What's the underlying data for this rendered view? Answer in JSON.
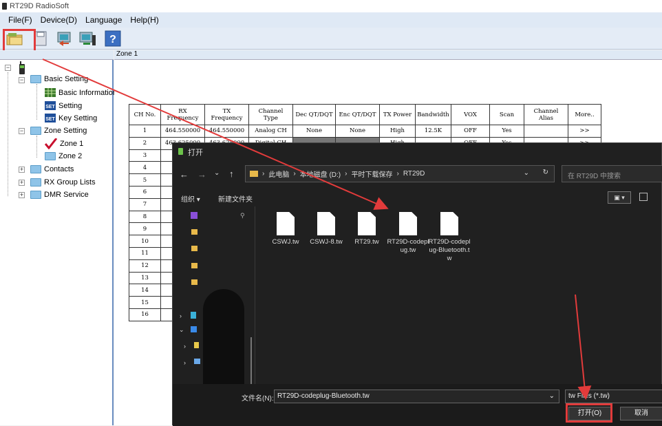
{
  "app": {
    "title": "RT29D RadioSoft"
  },
  "menu": {
    "file": "File(F)",
    "device": "Device(D)",
    "language": "Language",
    "help": "Help(H)"
  },
  "tree": {
    "basic_setting": "Basic Setting",
    "basic_information": "Basic Information",
    "setting": "Setting",
    "key_setting": "Key Setting",
    "zone_setting": "Zone Setting",
    "zone1": "Zone 1",
    "zone2": "Zone 2",
    "contacts": "Contacts",
    "rx_group_lists": "RX Group Lists",
    "dmr_service": "DMR Service"
  },
  "zone_header": "Zone 1",
  "table": {
    "headers": [
      "CH No.",
      "RX Frequency",
      "TX Frequency",
      "Channel Type",
      "Dec QT/DQT",
      "Enc QT/DQT",
      "TX Power",
      "Bandwidth",
      "VOX",
      "Scan",
      "Channel Alias",
      "More.."
    ],
    "rows": [
      [
        "1",
        "464.550000",
        "464.550000",
        "Analog CH",
        "None",
        "None",
        "High",
        "12.5K",
        "OFF",
        "Yes",
        "",
        ">>"
      ],
      [
        "2",
        "463.625000",
        "463.625000",
        "Digital CH",
        "",
        "",
        "High",
        "",
        "OFF",
        "Yes",
        "",
        ">>"
      ],
      [
        "3",
        "46",
        "",
        "",
        "",
        "",
        "",
        "",
        "",
        "",
        "",
        ""
      ],
      [
        "4",
        "46",
        "",
        "",
        "",
        "",
        "",
        "",
        "",
        "",
        "",
        ""
      ],
      [
        "5",
        "46",
        "",
        "",
        "",
        "",
        "",
        "",
        "",
        "",
        "",
        ""
      ],
      [
        "6",
        "46",
        "",
        "",
        "",
        "",
        "",
        "",
        "",
        "",
        "",
        ""
      ],
      [
        "7",
        "46",
        "",
        "",
        "",
        "",
        "",
        "",
        "",
        "",
        "",
        ""
      ],
      [
        "8",
        "46",
        "",
        "",
        "",
        "",
        "",
        "",
        "",
        "",
        "",
        ""
      ],
      [
        "9",
        "46",
        "",
        "",
        "",
        "",
        "",
        "",
        "",
        "",
        "",
        ""
      ],
      [
        "10",
        "46",
        "",
        "",
        "",
        "",
        "",
        "",
        "",
        "",
        "",
        ""
      ],
      [
        "11",
        "46",
        "",
        "",
        "",
        "",
        "",
        "",
        "",
        "",
        "",
        ""
      ],
      [
        "12",
        "46",
        "",
        "",
        "",
        "",
        "",
        "",
        "",
        "",
        "",
        ""
      ],
      [
        "13",
        "46",
        "",
        "",
        "",
        "",
        "",
        "",
        "",
        "",
        "",
        ""
      ],
      [
        "14",
        "46",
        "",
        "",
        "",
        "",
        "",
        "",
        "",
        "",
        "",
        ""
      ],
      [
        "15",
        "46",
        "",
        "",
        "",
        "",
        "",
        "",
        "",
        "",
        "",
        ""
      ],
      [
        "16",
        "46",
        "",
        "",
        "",
        "",
        "",
        "",
        "",
        "",
        "",
        ""
      ]
    ]
  },
  "dialog": {
    "title": "打开",
    "breadcrumb": [
      "此电脑",
      "本地磁盘 (D:)",
      "平时下载保存",
      "RT29D"
    ],
    "search_placeholder": "在 RT29D 中搜索",
    "organize": "组织",
    "new_folder": "新建文件夹",
    "files": [
      "CSWJ.tw",
      "CSWJ-8.tw",
      "RT29.tw",
      "RT29D-codeplug.tw",
      "RT29D-codeplug-Bluetooth.tw"
    ],
    "filename_label": "文件名(N):",
    "filename_value": "RT29D-codeplug-Bluetooth.tw",
    "filetype": "tw Files (*.tw)",
    "open_button": "打开(O)",
    "cancel_button": "取消"
  },
  "colors": {
    "annotation": "#e23b3b",
    "dialog_bg": "#202020",
    "menu_bg": "#dfe9f5"
  }
}
